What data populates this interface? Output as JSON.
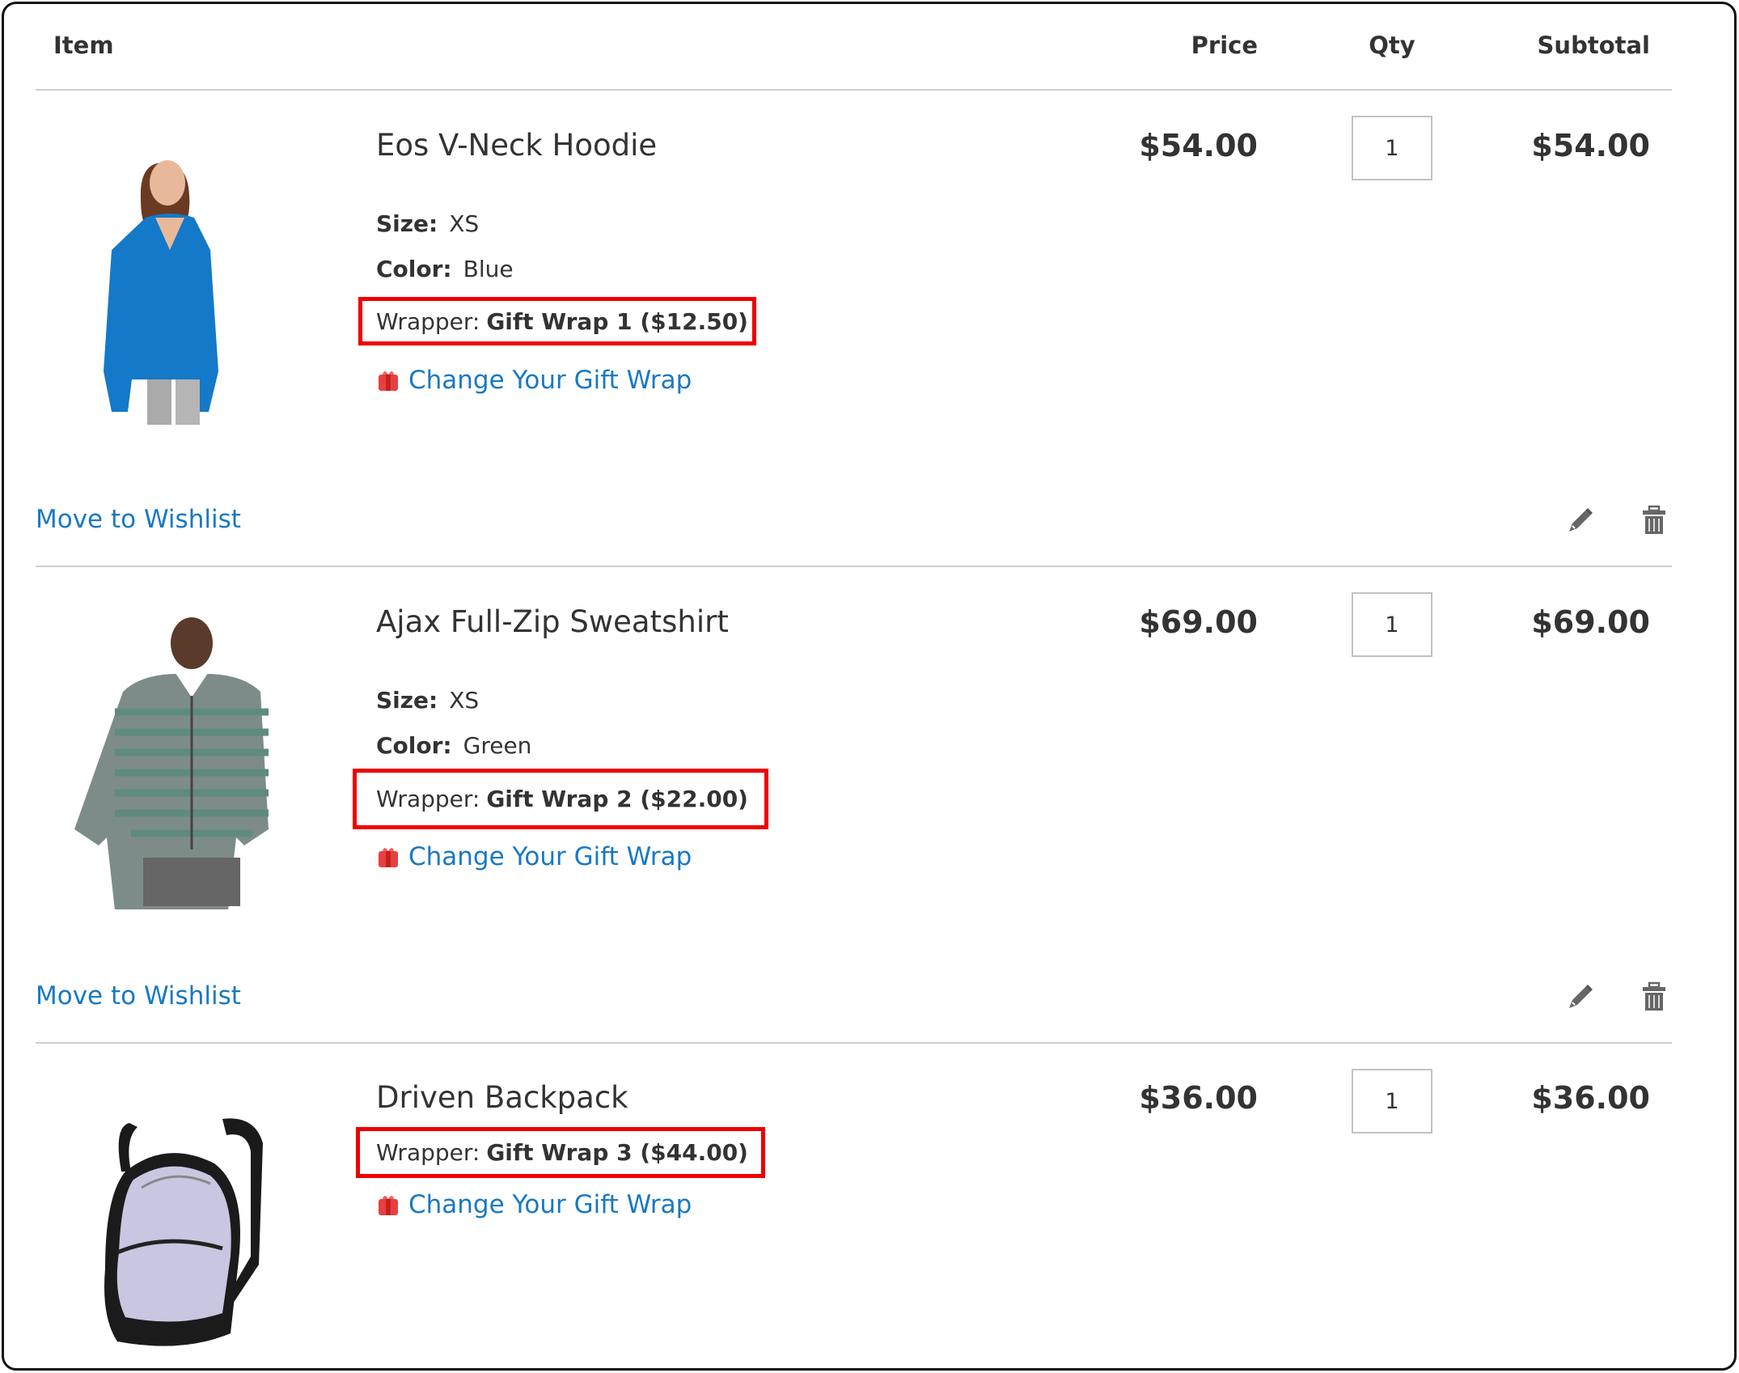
{
  "header": {
    "item": "Item",
    "price": "Price",
    "qty": "Qty",
    "subtotal": "Subtotal"
  },
  "colors": {
    "link": "#1979c3",
    "highlight": "#e00000",
    "text": "#333333"
  },
  "items": [
    {
      "name": "Eos V-Neck Hoodie",
      "size_label": "Size:",
      "size": "XS",
      "color_label": "Color:",
      "color": "Blue",
      "wrapper_label": "Wrapper:",
      "wrapper": "Gift Wrap 1 ($12.50)",
      "change_link": "Change Your Gift Wrap",
      "price": "$54.00",
      "qty": "1",
      "subtotal": "$54.00",
      "wishlist": "Move to Wishlist",
      "image": "blue hoodie"
    },
    {
      "name": "Ajax Full-Zip Sweatshirt",
      "size_label": "Size:",
      "size": "XS",
      "color_label": "Color:",
      "color": "Green",
      "wrapper_label": "Wrapper:",
      "wrapper": "Gift Wrap 2 ($22.00)",
      "change_link": "Change Your Gift Wrap",
      "price": "$69.00",
      "qty": "1",
      "subtotal": "$69.00",
      "wishlist": "Move to Wishlist",
      "image": "striped sweatshirt"
    },
    {
      "name": "Driven Backpack",
      "wrapper_label": "Wrapper:",
      "wrapper": "Gift Wrap 3 ($44.00)",
      "change_link": "Change Your Gift Wrap",
      "price": "$36.00",
      "qty": "1",
      "subtotal": "$36.00",
      "image": "backpack"
    }
  ],
  "icons": {
    "gift": "gift-icon",
    "edit": "pencil-icon",
    "delete": "trash-icon"
  }
}
